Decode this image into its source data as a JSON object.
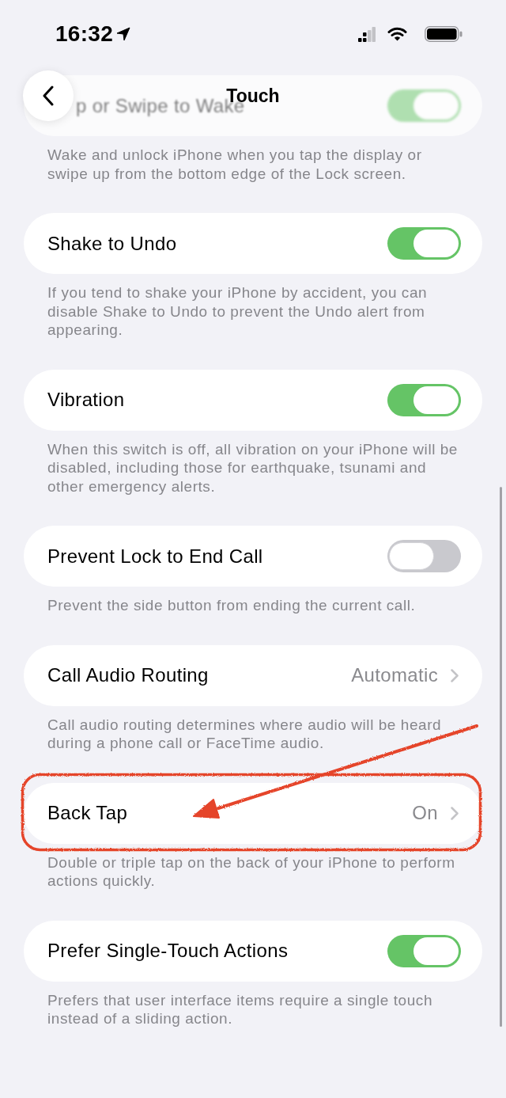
{
  "status_bar": {
    "time": "16:32"
  },
  "nav": {
    "title": "Touch"
  },
  "sections": [
    {
      "label": "p or Swipe to Wake",
      "kind": "toggle",
      "on": true,
      "blurred": true,
      "highlighted": false,
      "footer": "Wake and unlock iPhone when you tap the display or swipe up from the bottom edge of the Lock screen."
    },
    {
      "label": "Shake to Undo",
      "kind": "toggle",
      "on": true,
      "blurred": false,
      "highlighted": false,
      "footer": "If you tend to shake your iPhone by accident, you can disable Shake to Undo to prevent the Undo alert from appearing."
    },
    {
      "label": "Vibration",
      "kind": "toggle",
      "on": true,
      "blurred": false,
      "highlighted": false,
      "footer": "When this switch is off, all vibration on your iPhone will be disabled, including those for earthquake, tsunami and other emergency alerts."
    },
    {
      "label": "Prevent Lock to End Call",
      "kind": "toggle",
      "on": false,
      "blurred": false,
      "highlighted": false,
      "footer": "Prevent the side button from ending the current call."
    },
    {
      "label": "Call Audio Routing",
      "kind": "link",
      "value": "Automatic",
      "blurred": false,
      "highlighted": false,
      "footer": "Call audio routing determines where audio will be heard during a phone call or FaceTime audio."
    },
    {
      "label": "Back Tap",
      "kind": "link",
      "value": "On",
      "blurred": false,
      "highlighted": true,
      "footer": "Double or triple tap on the back of your iPhone to perform actions quickly."
    },
    {
      "label": "Prefer Single-Touch Actions",
      "kind": "toggle",
      "on": true,
      "blurred": false,
      "highlighted": false,
      "footer": "Prefers that user interface items require a single touch instead of a sliding action."
    }
  ]
}
